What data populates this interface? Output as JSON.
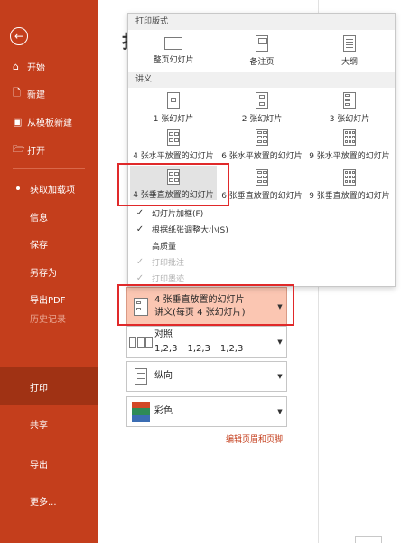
{
  "sidebar": {
    "items": [
      {
        "icon": "home-icon",
        "label": "开始"
      },
      {
        "icon": "new-doc-icon",
        "label": "新建"
      },
      {
        "icon": "template-icon",
        "label": "从模板新建"
      },
      {
        "icon": "folder-open-icon",
        "label": "打开"
      },
      {
        "label": "获取加载项"
      },
      {
        "label": "信息"
      },
      {
        "label": "保存"
      },
      {
        "label": "另存为"
      },
      {
        "label": "导出PDF"
      },
      {
        "label": "历史记录"
      },
      {
        "label": "打印"
      },
      {
        "label": "共享"
      },
      {
        "label": "导出"
      },
      {
        "label": "更多..."
      }
    ]
  },
  "main": {
    "title": "打"
  },
  "popup": {
    "print_layout_header": "打印版式",
    "layout_options": [
      "整页幻灯片",
      "备注页",
      "大纲"
    ],
    "handouts_header": "讲义",
    "handout_options": [
      "1 张幻灯片",
      "2 张幻灯片",
      "3 张幻灯片",
      "4 张水平放置的幻灯片",
      "6 张水平放置的幻灯片",
      "9 张水平放置的幻灯片",
      "4 张垂直放置的幻灯片",
      "6 张垂直放置的幻灯片",
      "9 张垂直放置的幻灯片"
    ],
    "checks": [
      {
        "label": "幻灯片加框(F)",
        "checked": true,
        "enabled": true
      },
      {
        "label": "根据纸张调整大小(S)",
        "checked": true,
        "enabled": true
      },
      {
        "label": "高质量",
        "checked": false,
        "enabled": true
      },
      {
        "label": "打印批注",
        "checked": true,
        "enabled": false
      },
      {
        "label": "打印墨迹",
        "checked": true,
        "enabled": false
      }
    ]
  },
  "settings": {
    "layout_dropdown": {
      "line1": "4 张垂直放置的幻灯片",
      "line2": "讲义(每页 4 张幻灯片)"
    },
    "collate_dropdown": {
      "label": "对照",
      "nums": [
        "1,2,3",
        "1,2,3",
        "1,2,3"
      ]
    },
    "orientation_dropdown": {
      "label": "纵向"
    },
    "color_dropdown": {
      "label": "彩色"
    },
    "edit_header_footer": "编辑页眉和页脚"
  },
  "colors": {
    "sidebar_bg": "#c43e1c",
    "active_item_bg": "#a03214",
    "selected_dropdown_bg": "#fbc6b2",
    "highlight_border": "#e0292a"
  }
}
